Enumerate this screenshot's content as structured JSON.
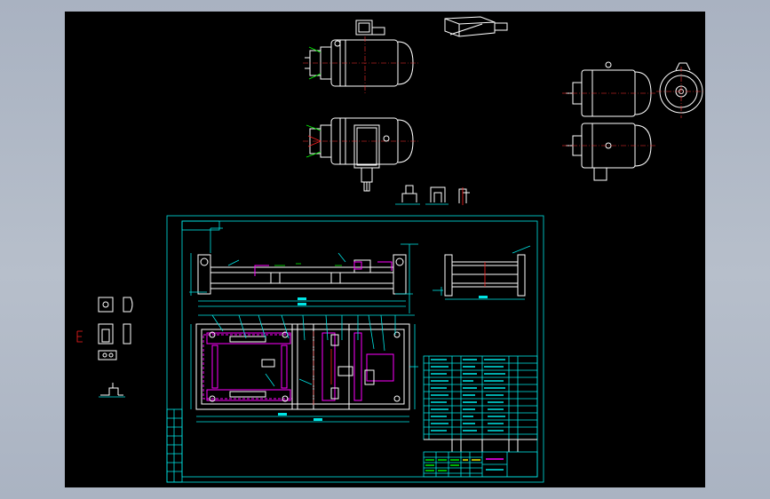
{
  "colors": {
    "window_bg": "#b1b9c6",
    "canvas_bg": "#000000",
    "outline": "#ffffff",
    "dimension": "#00e5e5",
    "frame": "#00e5e5",
    "hidden_part": "#ff00ff",
    "weld": "#00ff00",
    "centerline": "#ff3030"
  },
  "drawing": {
    "parts_list_rows": 12,
    "parts_list_columns": 7,
    "views": [
      "motor-top-view",
      "motor-front-view",
      "motor-side-view",
      "frame-front-view",
      "frame-top-view",
      "frame-side-view",
      "part-details"
    ]
  }
}
